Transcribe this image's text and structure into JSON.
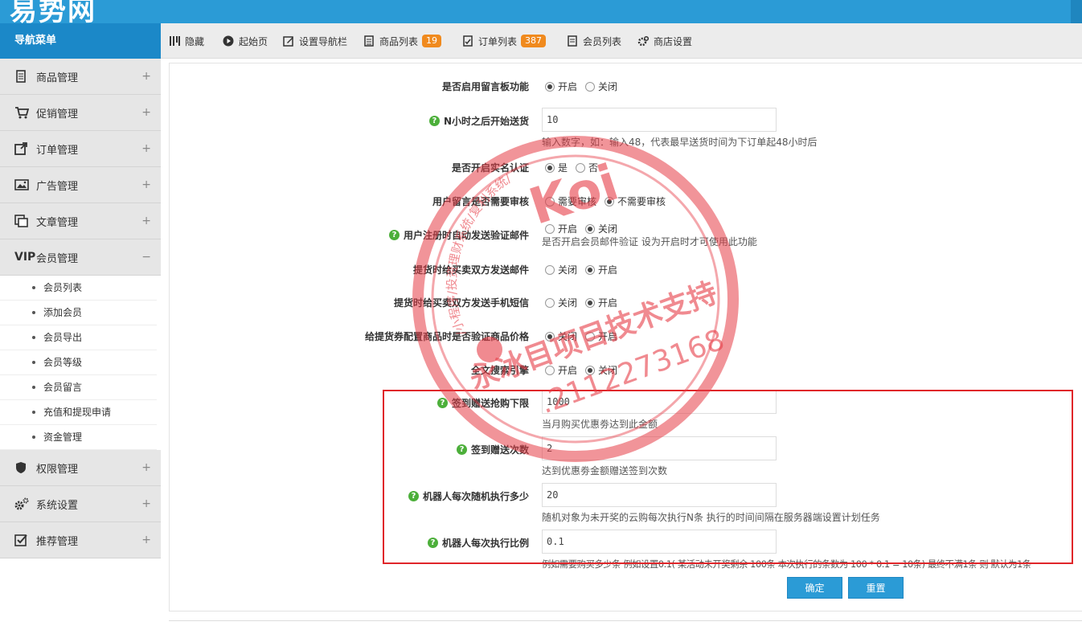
{
  "header": {
    "logo": "易势网"
  },
  "nav": {
    "title": "导航菜单"
  },
  "toolbar": [
    {
      "label": "隐藏",
      "icon": "hide-icon"
    },
    {
      "label": "起始页",
      "icon": "play-circle-icon"
    },
    {
      "label": "设置导航栏",
      "icon": "edit-nav-icon"
    },
    {
      "label": "商品列表",
      "icon": "list-icon",
      "badge": "19"
    },
    {
      "label": "订单列表",
      "icon": "order-icon",
      "badge": "387"
    },
    {
      "label": "会员列表",
      "icon": "member-list-icon"
    },
    {
      "label": "商店设置",
      "icon": "shop-settings-icon"
    }
  ],
  "sidebar": {
    "menus": [
      {
        "label": "商品管理",
        "icon": "goods-icon",
        "toggle": "+"
      },
      {
        "label": "促销管理",
        "icon": "cart-icon",
        "toggle": "+"
      },
      {
        "label": "订单管理",
        "icon": "order-export-icon",
        "toggle": "+"
      },
      {
        "label": "广告管理",
        "icon": "image-icon",
        "toggle": "+"
      },
      {
        "label": "文章管理",
        "icon": "copy-icon",
        "toggle": "+"
      },
      {
        "label": "会员管理",
        "icon": "vip-icon",
        "toggle": "−"
      },
      {
        "label": "权限管理",
        "icon": "shield-icon",
        "toggle": "+"
      },
      {
        "label": "系统设置",
        "icon": "gears-icon",
        "toggle": "+"
      },
      {
        "label": "推荐管理",
        "icon": "checkbox-icon",
        "toggle": "+"
      }
    ],
    "member_sub": [
      "会员列表",
      "添加会员",
      "会员导出",
      "会员等级",
      "会员留言",
      "充值和提现申请",
      "资金管理"
    ]
  },
  "form": {
    "guestbook": {
      "label": "是否启用留言板功能",
      "opt1": "开启",
      "opt2": "关闭"
    },
    "n_hours": {
      "label": "N小时之后开始送货",
      "value": "10",
      "hint": "输入数字，如：输入48，代表最早送货时间为下订单起48小时后"
    },
    "realname": {
      "label": "是否开启实名认证",
      "opt1": "是",
      "opt2": "否"
    },
    "review": {
      "label": "用户留言是否需要审核",
      "opt1": "需要审核",
      "opt2": "不需要审核"
    },
    "reg_mail": {
      "label": "用户注册时自动发送验证邮件",
      "opt1": "开启",
      "opt2": "关闭",
      "hint": "是否开启会员邮件验证 设为开启时才可使用此功能"
    },
    "pickup_mail": {
      "label": "提货时给买卖双方发送邮件",
      "opt1": "关闭",
      "opt2": "开启"
    },
    "pickup_sms": {
      "label": "提货时给买卖双方发送手机短信",
      "opt1": "关闭",
      "opt2": "开启"
    },
    "verify_price": {
      "label": "给提货券配置商品时是否验证商品价格",
      "opt1": "关闭",
      "opt2": "开启"
    },
    "fulltext": {
      "label": "全文搜索引擎",
      "opt1": "开启",
      "opt2": "关闭"
    },
    "sign_limit": {
      "label": "签到赠送抢购下限",
      "value": "1000",
      "hint": "当月购买优惠劵达到此金额"
    },
    "sign_times": {
      "label": "签到赠送次数",
      "value": "2",
      "hint": "达到优惠劵金额赠送签到次数"
    },
    "robot_count": {
      "label": "机器人每次随机执行多少",
      "value": "20",
      "hint": "随机对象为未开奖的云购每次执行N条 执行的时间间隔在服务器端设置计划任务"
    },
    "robot_ratio": {
      "label": "机器人每次执行比例",
      "value": "0.1",
      "hint": "例如需要购买多少条 例如设置0.1( 某活动未开奖剩余 100条 本次执行的条数为 100 * 0.1 = 10条) 最终不满1条 则 默认为1条"
    }
  },
  "buttons": {
    "confirm": "确定",
    "reset": "重置"
  },
  "watermark": {
    "brand": "Koi",
    "line1": "/小程序/投资理财系统/复利系统/",
    "line2": "永冰目项目技术支持",
    "line3": ".2112273168"
  },
  "colors": {
    "header_blue": "#2b9bd6",
    "nav_blue": "#1b88c8",
    "badge_orange": "#f08a1e",
    "highlight_red": "#e0262a",
    "help_green": "#4caf3a"
  }
}
